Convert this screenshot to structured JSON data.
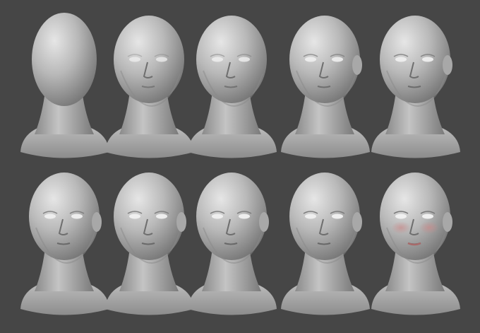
{
  "scene": {
    "subject": "sculpt-progression",
    "background_color": "#464646",
    "clay_color": "#b9b9b9",
    "clay_highlight": "#e6e6e6",
    "clay_shadow": "#6e6e6e",
    "blush_color": "#c98a8a",
    "rows": [
      {
        "name": "top-row",
        "heads": [
          {
            "stage": 1,
            "detail": "blank-egg",
            "features": 0.0
          },
          {
            "stage": 2,
            "detail": "rough-features",
            "features": 0.35
          },
          {
            "stage": 3,
            "detail": "refined-planes",
            "features": 0.5
          },
          {
            "stage": 4,
            "detail": "ears-added",
            "features": 0.7
          },
          {
            "stage": 5,
            "detail": "refined-face",
            "features": 0.8
          }
        ]
      },
      {
        "name": "bottom-row",
        "heads": [
          {
            "stage": 6,
            "detail": "detailed-face",
            "features": 0.85
          },
          {
            "stage": 7,
            "detail": "detailed-face",
            "features": 0.88
          },
          {
            "stage": 8,
            "detail": "detailed-face",
            "features": 0.92
          },
          {
            "stage": 9,
            "detail": "detailed-face",
            "features": 0.95
          },
          {
            "stage": 10,
            "detail": "painted-makeup",
            "features": 1.0,
            "blush": true
          }
        ]
      }
    ]
  }
}
